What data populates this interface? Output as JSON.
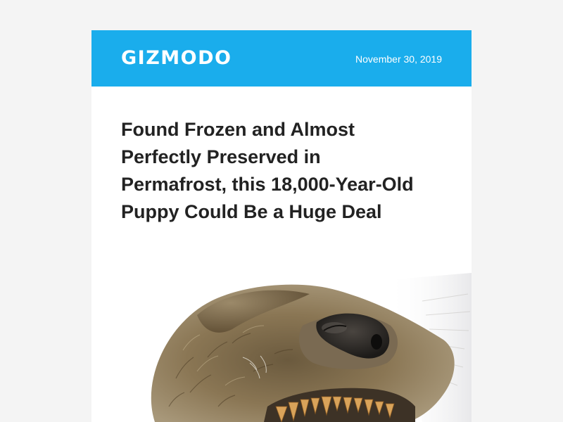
{
  "email": {
    "brand": "GIZMODO",
    "date": "November 30, 2019",
    "headline": "Found Frozen and Almost Perfectly Preserved in Permafrost, this 18,000-Year-Old Puppy Could Be a Huge Deal",
    "colors": {
      "masthead": "#1aadec",
      "page_background": "#f4f4f4",
      "headline_text": "#222222"
    },
    "hero_image": {
      "subject": "frozen-puppy-photo"
    }
  }
}
